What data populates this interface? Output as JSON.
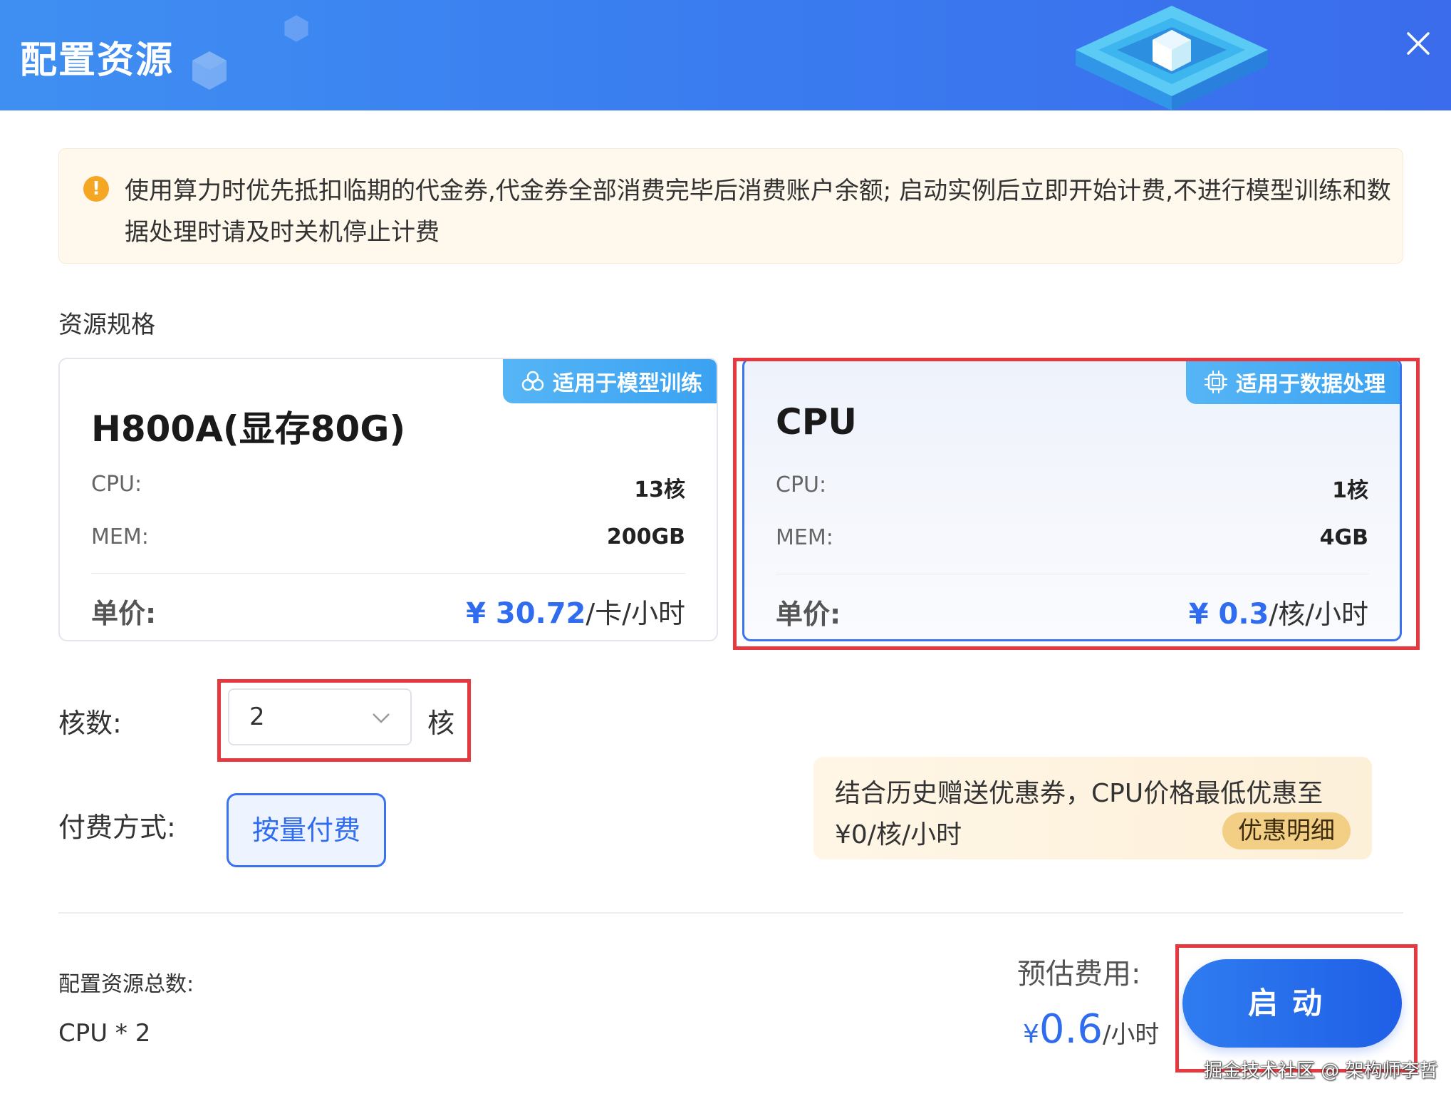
{
  "header": {
    "title": "配置资源",
    "close_icon": "close-icon"
  },
  "notice": {
    "icon": "warning-icon",
    "text": "使用算力时优先抵扣临期的代金券,代金券全部消费完毕后消费账户余额; 启动实例后立即开始计费,不进行模型训练和数据处理时请及时关机停止计费"
  },
  "section_label": "资源规格",
  "cards": [
    {
      "tag": "适用于模型训练",
      "tag_icon": "model-training-icon",
      "title": "H800A(显存80G)",
      "cpu_label": "CPU:",
      "cpu_value": "13核",
      "mem_label": "MEM:",
      "mem_value": "200GB",
      "price_label": "单价:",
      "price_value": "¥ 30.72",
      "price_unit": "/卡/小时",
      "selected": false
    },
    {
      "tag": "适用于数据处理",
      "tag_icon": "chip-icon",
      "title": "CPU",
      "cpu_label": "CPU:",
      "cpu_value": "1核",
      "mem_label": "MEM:",
      "mem_value": "4GB",
      "price_label": "单价:",
      "price_value": "¥ 0.3",
      "price_unit": "/核/小时",
      "selected": true
    }
  ],
  "cores": {
    "label": "核数:",
    "value": "2",
    "unit": "核"
  },
  "payment": {
    "label": "付费方式:",
    "option": "按量付费"
  },
  "promo": {
    "line1": "结合历史赠送优惠券，CPU价格最低优惠至",
    "line2": "¥0/核/小时",
    "button": "优惠明细"
  },
  "summary": {
    "total_label": "配置资源总数:",
    "total_value": "CPU * 2",
    "estimate_label": "预估费用:",
    "estimate_currency": "¥",
    "estimate_amount": "0.6",
    "estimate_unit": "/小时",
    "start_button": "启动"
  },
  "watermark": "掘金技术社区 @ 架构师李哲",
  "colors": {
    "accent": "#3a72f0",
    "highlight": "#e5393f",
    "warning": "#f5a623"
  }
}
